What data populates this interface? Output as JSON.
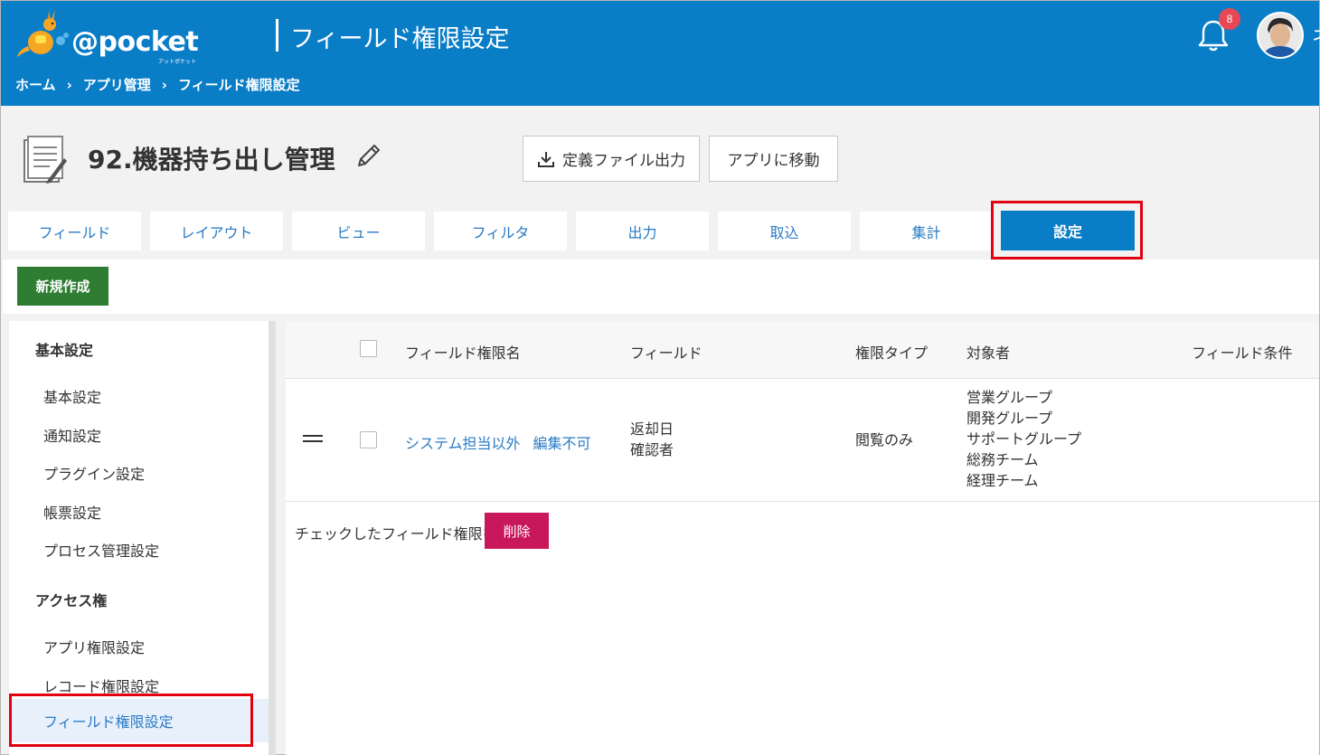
{
  "header": {
    "logo_text": "@pocket",
    "logo_sub": "アットポケット",
    "page_title": "フィールド権限設定",
    "breadcrumb": [
      "ホーム",
      "アプリ管理",
      "フィールド権限設定"
    ],
    "breadcrumb_sep": "›",
    "notification_count": "8",
    "user_char": "ネ"
  },
  "app": {
    "name": "92.機器持ち出し管理",
    "export_button": "定義ファイル出力",
    "move_button": "アプリに移動"
  },
  "tabs": [
    "フィールド",
    "レイアウト",
    "ビュー",
    "フィルタ",
    "出力",
    "取込",
    "集計",
    "設定"
  ],
  "active_tab_index": 7,
  "toolbar": {
    "new_button": "新規作成"
  },
  "sidebar": {
    "section1": "基本設定",
    "section1_items": [
      "基本設定",
      "通知設定",
      "プラグイン設定",
      "帳票設定",
      "プロセス管理設定"
    ],
    "section2": "アクセス権",
    "section2_items": [
      "アプリ権限設定",
      "レコード権限設定",
      "フィールド権限設定"
    ]
  },
  "table": {
    "headers": [
      "フィールド権限名",
      "フィールド",
      "権限タイプ",
      "対象者",
      "フィールド条件"
    ],
    "rows": [
      {
        "name_part1": "システム担当以外",
        "name_part2": "編集不可",
        "fields": [
          "返却日",
          "確認者"
        ],
        "permission_type": "閲覧のみ",
        "targets": [
          "営業グループ",
          "開発グループ",
          "サポートグループ",
          "総務チーム",
          "経理チーム"
        ],
        "condition": ""
      }
    ]
  },
  "footer": {
    "label": "チェックしたフィールド権限を",
    "delete_button": "削除"
  },
  "colors": {
    "header_bg": "#0a7dc7",
    "link": "#2a7bc4",
    "new_button": "#2e7d32",
    "delete_button": "#c8185b",
    "highlight": "#e00010"
  }
}
